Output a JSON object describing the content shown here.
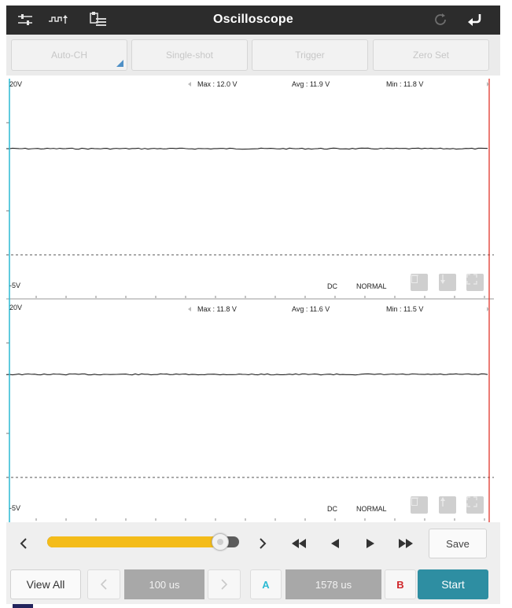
{
  "toolbar": {
    "title": "Oscilloscope",
    "icons": [
      "sliders-icon",
      "waveform-icon",
      "file-list-icon",
      "refresh-icon",
      "back-icon"
    ]
  },
  "top_buttons": {
    "auto_ch": "Auto-CH",
    "single_shot": "Single-shot",
    "trigger": "Trigger",
    "zero_set": "Zero Set"
  },
  "channels": [
    {
      "top_scale": "20V",
      "bottom_scale": "-5V",
      "max": "Max : 12.0 V",
      "avg": "Avg : 11.9 V",
      "min": "Min : 11.8 V",
      "coupling": "DC",
      "mode": "NORMAL"
    },
    {
      "top_scale": "20V",
      "bottom_scale": "-5V",
      "max": "Max : 11.8 V",
      "avg": "Avg : 11.6 V",
      "min": "Min : 11.5 V",
      "coupling": "DC",
      "mode": "NORMAL"
    }
  ],
  "scroll": {
    "position_fraction": 0.9,
    "save_label": "Save"
  },
  "bottom_bar": {
    "view_all": "View All",
    "timebase": "100 us",
    "marker_a": "A",
    "cursor_value": "1578 us",
    "marker_b": "B",
    "start": "Start"
  },
  "colors": {
    "title_bar": "#2c2c2c",
    "slider_fill": "#f4bc1a",
    "start_button": "#2e8ea2",
    "cursor_a": "#2bbad3",
    "cursor_b": "#e0352b",
    "marker_a_text": "#2bbad3",
    "marker_b_text": "#d0262a"
  }
}
